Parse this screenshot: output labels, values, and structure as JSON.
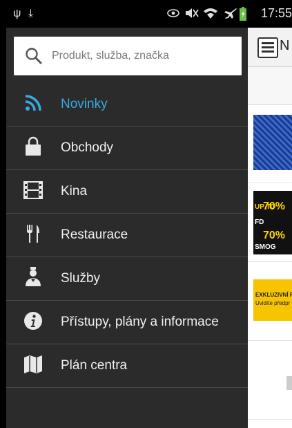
{
  "status_bar": {
    "time": "17:55",
    "icons": [
      "usb-icon",
      "download-icon",
      "eye-icon",
      "mute-icon",
      "wifi-icon",
      "airplane-icon",
      "battery-icon"
    ]
  },
  "background_app": {
    "header_letter": "N",
    "items": [
      {
        "thumb": "blue-patterned-image"
      },
      {
        "thumb": "sale-banner",
        "texts": [
          "UP TO",
          "70%",
          "FD",
          "70%",
          "SMOG"
        ]
      },
      {
        "thumb": "exclusive-banner",
        "texts": [
          "EXKLUZIVNÍ P",
          "Uvidíte předpr"
        ]
      },
      {
        "thumb": "gray-image"
      }
    ]
  },
  "drawer": {
    "search_placeholder": "Produkt, služba, značka",
    "items": [
      {
        "label": "Novinky",
        "icon": "rss-icon",
        "active": true
      },
      {
        "label": "Obchody",
        "icon": "shopping-bag-icon",
        "active": false
      },
      {
        "label": "Kina",
        "icon": "film-strip-icon",
        "active": false
      },
      {
        "label": "Restaurace",
        "icon": "fork-knife-icon",
        "active": false
      },
      {
        "label": "Služby",
        "icon": "waiter-icon",
        "active": false
      },
      {
        "label": "Přístupy, plány a informace",
        "icon": "info-icon",
        "active": false
      },
      {
        "label": "Plán centra",
        "icon": "map-icon",
        "active": false
      }
    ],
    "active_color": "#3aa9de",
    "background_color": "#2b2b2b"
  }
}
